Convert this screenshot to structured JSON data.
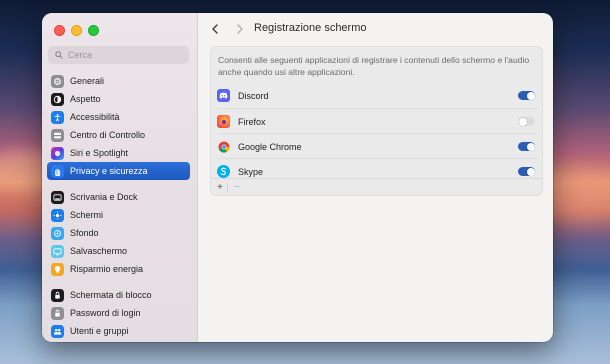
{
  "search": {
    "placeholder": "Cerca"
  },
  "sidebar": {
    "groups": [
      [
        {
          "label": "Generali",
          "icon": "gear-icon",
          "color": "#8e8e93"
        },
        {
          "label": "Aspetto",
          "icon": "appearance-icon",
          "color": "#1c1c1e"
        },
        {
          "label": "Accessibilità",
          "icon": "accessibility-icon",
          "color": "#1a7df0"
        },
        {
          "label": "Centro di Controllo",
          "icon": "control-center-icon",
          "color": "#8e8e93"
        },
        {
          "label": "Siri e Spotlight",
          "icon": "siri-icon",
          "color": "#222"
        },
        {
          "label": "Privacy e sicurezza",
          "icon": "hand-icon",
          "color": "#2a78ee",
          "active": true
        }
      ],
      [
        {
          "label": "Scrivania e Dock",
          "icon": "dock-icon",
          "color": "#1c1c1e"
        },
        {
          "label": "Schermi",
          "icon": "display-icon",
          "color": "#1a7df0"
        },
        {
          "label": "Sfondo",
          "icon": "wallpaper-icon",
          "color": "#38a8f5"
        },
        {
          "label": "Salvaschermo",
          "icon": "screensaver-icon",
          "color": "#5ac8e8"
        },
        {
          "label": "Risparmio energia",
          "icon": "energy-icon",
          "color": "#f5a623"
        }
      ],
      [
        {
          "label": "Schermata di blocco",
          "icon": "lock-screen-icon",
          "color": "#1c1c1e"
        },
        {
          "label": "Password di login",
          "icon": "lock-icon",
          "color": "#8e8e93"
        },
        {
          "label": "Utenti e gruppi",
          "icon": "users-icon",
          "color": "#1a7df0"
        }
      ]
    ]
  },
  "header": {
    "title": "Registrazione schermo"
  },
  "panel": {
    "description": "Consenti alle seguenti applicazioni di registrare i contenuti dello schermo e l'audio anche quando usi altre applicazioni.",
    "apps": [
      {
        "name": "Discord",
        "icon": "discord-icon",
        "enabled": true
      },
      {
        "name": "Firefox",
        "icon": "firefox-icon",
        "enabled": false
      },
      {
        "name": "Google Chrome",
        "icon": "chrome-icon",
        "enabled": true
      },
      {
        "name": "Skype",
        "icon": "skype-icon",
        "enabled": true
      }
    ],
    "add_label": "+",
    "remove_label": "−"
  }
}
